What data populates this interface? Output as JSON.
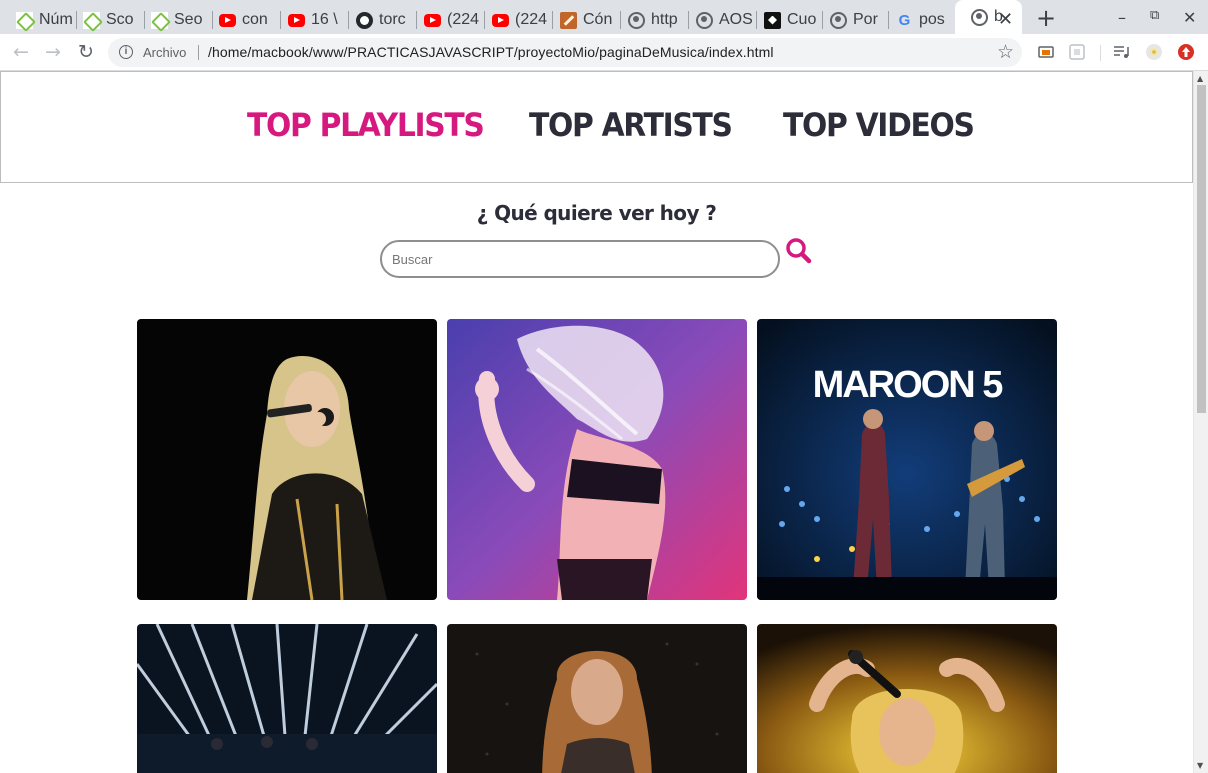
{
  "browser": {
    "tabs": [
      {
        "title": "Núm",
        "icon": "leaf-icon"
      },
      {
        "title": "Sco",
        "icon": "leaf-icon"
      },
      {
        "title": "Seo",
        "icon": "leaf-icon"
      },
      {
        "title": "con",
        "icon": "youtube-icon"
      },
      {
        "title": "16 \\",
        "icon": "youtube-icon"
      },
      {
        "title": "torc",
        "icon": "github-icon"
      },
      {
        "title": "(224",
        "icon": "youtube-icon"
      },
      {
        "title": "(224",
        "icon": "youtube-icon"
      },
      {
        "title": "Cón",
        "icon": "pencil-icon"
      },
      {
        "title": "http",
        "icon": "globe-icon"
      },
      {
        "title": "AOS",
        "icon": "globe-icon"
      },
      {
        "title": "Cuo",
        "icon": "cuo-icon"
      },
      {
        "title": "Por",
        "icon": "globe-icon"
      },
      {
        "title": "pos",
        "icon": "google-icon"
      },
      {
        "title": "b",
        "icon": "globe-icon",
        "active": true
      }
    ],
    "address": {
      "scheme_label": "Archivo",
      "url": "/home/macbook/www/PRACTICASJAVASCRIPT/proyectoMio/paginaDeMusica/index.html"
    }
  },
  "page": {
    "nav": {
      "playlists": "TOP PLAYLISTS",
      "artists": "TOP ARTISTS",
      "videos": "TOP VIDEOS",
      "active_color": "#d6197f",
      "text_color": "#2d2d3a"
    },
    "question": "¿ Qué quiere ver hoy ?",
    "search": {
      "placeholder": "Buscar"
    },
    "cards": [
      {
        "image": "singer-black-background"
      },
      {
        "image": "dancer-purple-pink-gradient"
      },
      {
        "image": "maroon5-concert",
        "caption": "MAROON 5"
      },
      {
        "image": "concert-stage-lights"
      },
      {
        "image": "curly-hair-singer"
      },
      {
        "image": "blonde-singer-yellow"
      }
    ]
  }
}
